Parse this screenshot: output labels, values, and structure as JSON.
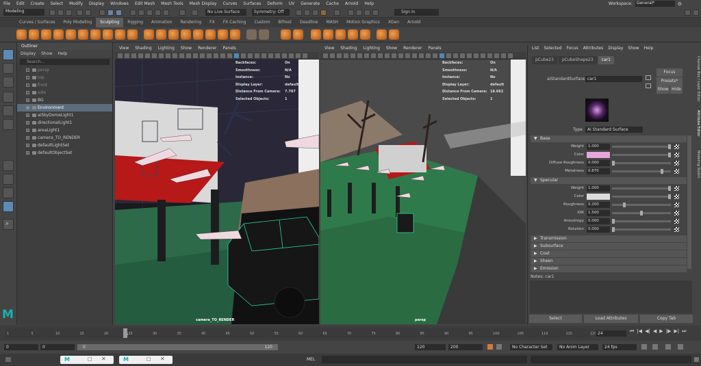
{
  "menubar": {
    "items": [
      "File",
      "Edit",
      "Create",
      "Select",
      "Modify",
      "Display",
      "Windows",
      "Edit Mesh",
      "Mesh Tools",
      "Mesh Display",
      "Curves",
      "Surfaces",
      "Deform",
      "UV",
      "Generate",
      "Cache",
      "Arnold",
      "Help"
    ],
    "workspace_label": "Workspace:",
    "workspace_value": "General*"
  },
  "statusline": {
    "mode": "Modeling",
    "live_surface": "No Live Surface",
    "symmetry": "Symmetry: Off",
    "sign_in": "Sign In"
  },
  "shelf": {
    "tabs": [
      "Curves / Surfaces",
      "Poly Modeling",
      "Sculpting",
      "Rigging",
      "Animation",
      "Rendering",
      "FX",
      "FX Caching",
      "Custom",
      "Bifrost",
      "Deadline",
      "MASH",
      "Motion Graphics",
      "XGen",
      "Arnold"
    ],
    "active_tab": "Sculpting"
  },
  "outliner": {
    "title": "Outliner",
    "menu": [
      "Display",
      "Show",
      "Help"
    ],
    "search_placeholder": "Search...",
    "items": [
      {
        "label": "persp",
        "dim": true
      },
      {
        "label": "top",
        "dim": true
      },
      {
        "label": "front",
        "dim": true
      },
      {
        "label": "side",
        "dim": true
      },
      {
        "label": "BG",
        "dim": false
      },
      {
        "label": "Environment",
        "dim": false,
        "selected": true
      },
      {
        "label": "aiSkyDomeLight1",
        "dim": false
      },
      {
        "label": "directionalLight1",
        "dim": false
      },
      {
        "label": "areaLight1",
        "dim": false
      },
      {
        "label": "camera_TO_RENDER",
        "dim": false
      },
      {
        "label": "defaultLightSet",
        "dim": false
      },
      {
        "label": "defaultObjectSet",
        "dim": false
      }
    ]
  },
  "viewport_menu": [
    "View",
    "Shading",
    "Lighting",
    "Show",
    "Renderer",
    "Panels"
  ],
  "viewport_left": {
    "hud": [
      {
        "k": "Backfaces:",
        "v": "On"
      },
      {
        "k": "Smoothness:",
        "v": "N/A"
      },
      {
        "k": "Instance:",
        "v": "No"
      },
      {
        "k": "Display Layer:",
        "v": "default"
      },
      {
        "k": "Distance From Camera:",
        "v": "7.787"
      },
      {
        "k": "Selected Objects:",
        "v": "1"
      }
    ],
    "camera": "camera_TO_RENDER"
  },
  "viewport_right": {
    "hud": [
      {
        "k": "Backfaces:",
        "v": "On"
      },
      {
        "k": "Smoothness:",
        "v": "N/A"
      },
      {
        "k": "Instance:",
        "v": "No"
      },
      {
        "k": "Display Layer:",
        "v": "default"
      },
      {
        "k": "Distance From Camera:",
        "v": "18.662"
      },
      {
        "k": "Selected Objects:",
        "v": "1"
      }
    ],
    "camera": "persp"
  },
  "attribute_editor": {
    "menu": [
      "List",
      "Selected",
      "Focus",
      "Attributes",
      "Display",
      "Show",
      "Help"
    ],
    "tabs": [
      "pCube23",
      "pCubeShape23",
      "car1"
    ],
    "active_tab": "car1",
    "node_label": "aiStandardSurface:",
    "node_value": "car1",
    "focus_btn": "Focus",
    "presets_btn": "Presets*",
    "show_btn": "Show",
    "hide_btn": "Hide",
    "type_label": "Type",
    "type_value": "Ai Standard Surface",
    "base_section": "Base",
    "base": [
      {
        "label": "Weight",
        "value": "1.000",
        "fill": 1.0
      },
      {
        "label": "Color",
        "value": "",
        "swatch": "#e7a6d9",
        "fill": 1.0
      },
      {
        "label": "Diffuse Roughness",
        "value": "0.000",
        "fill": 0.0
      },
      {
        "label": "Metalness",
        "value": "0.870",
        "fill": 0.87
      }
    ],
    "specular_section": "Specular",
    "specular": [
      {
        "label": "Weight",
        "value": "1.000",
        "fill": 1.0
      },
      {
        "label": "Color",
        "value": "",
        "swatch": "#dcdcdc",
        "fill": 1.0
      },
      {
        "label": "Roughness",
        "value": "0.200",
        "fill": 0.2
      },
      {
        "label": "IOR",
        "value": "1.500",
        "fill": 0.5
      },
      {
        "label": "Anisotropy",
        "value": "0.000",
        "fill": 0.0
      },
      {
        "label": "Rotation",
        "value": "0.000",
        "fill": 0.0
      }
    ],
    "collapsed_sections": [
      "Transmission",
      "Subsurface",
      "Coat",
      "Sheen",
      "Emission"
    ],
    "notes_label": "Notes:",
    "notes_value": "car1",
    "buttons": [
      "Select",
      "Load Attributes",
      "Copy Tab"
    ],
    "side_tabs": [
      "Channel Box / Layer Editor",
      "Attribute Editor",
      "Modeling Toolkit"
    ]
  },
  "timeline": {
    "ticks": [
      "1",
      "5",
      "10",
      "15",
      "20",
      "25",
      "30",
      "35",
      "40",
      "45",
      "50",
      "55",
      "60",
      "65",
      "70",
      "75",
      "80",
      "85",
      "90",
      "95",
      "100",
      "105",
      "110",
      "115",
      "120"
    ],
    "current_frame": "24",
    "current_frame_field": "24"
  },
  "range": {
    "start": "0",
    "anim_start": "0",
    "range_start": "0",
    "range_end": "120",
    "end": "120",
    "anim_end": "200",
    "character_set": "No Character Set",
    "anim_layer": "No Anim Layer",
    "fps": "24 fps"
  },
  "cmdline": {
    "language": "MEL"
  }
}
